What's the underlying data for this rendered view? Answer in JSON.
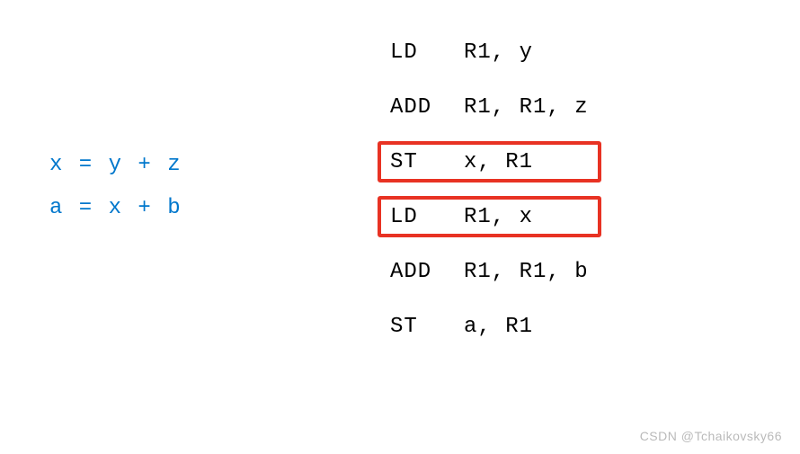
{
  "source": {
    "lines": [
      "x = y + z",
      "a = x + b"
    ]
  },
  "assembly": {
    "instructions": [
      {
        "op": "LD",
        "args": "R1, y",
        "highlight": false
      },
      {
        "op": "ADD",
        "args": "R1, R1, z",
        "highlight": false
      },
      {
        "op": "ST",
        "args": "x, R1",
        "highlight": true
      },
      {
        "op": "LD",
        "args": "R1, x",
        "highlight": true
      },
      {
        "op": "ADD",
        "args": "R1, R1, b",
        "highlight": false
      },
      {
        "op": "ST",
        "args": "a, R1",
        "highlight": false
      }
    ]
  },
  "watermark": "CSDN @Tchaikovsky66"
}
